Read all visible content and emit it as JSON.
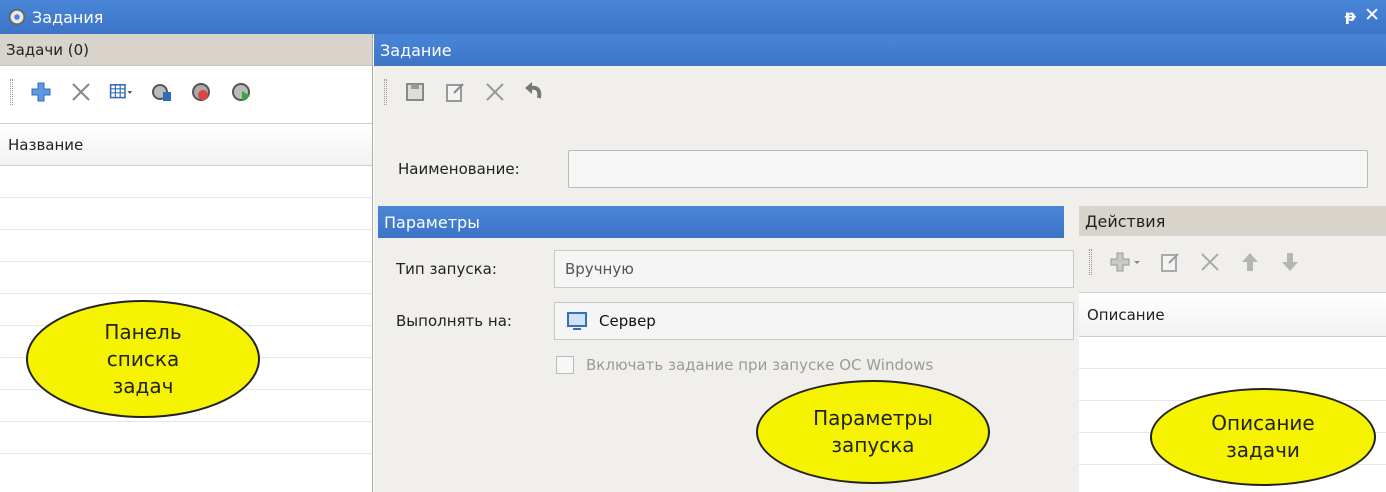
{
  "window": {
    "title": "Задания",
    "pin_glyph": "ᵽ",
    "close_glyph": "✕"
  },
  "left_panel": {
    "header": "Задачи (0)",
    "toolbar": [
      "add-icon",
      "delete-icon",
      "view-grid-icon",
      "task-run-icon",
      "task-stop-icon",
      "task-start-icon"
    ],
    "column_header": "Название",
    "row_count": 9
  },
  "task_panel": {
    "header": "Задание",
    "toolbar": [
      "save-icon",
      "edit-icon",
      "delete-icon",
      "undo-icon"
    ],
    "name_label": "Наименование:",
    "name_value": ""
  },
  "params_panel": {
    "header": "Параметры",
    "launch_type_label": "Тип запуска:",
    "launch_type_value": "Вручную",
    "run_on_label": "Выполнять на:",
    "run_on_value": "Сервер",
    "checkbox_label": "Включать задание при запуске ОС Windows",
    "checkbox_checked": false
  },
  "actions_panel": {
    "header": "Действия",
    "toolbar": [
      "add-icon",
      "edit-icon",
      "delete-icon",
      "move-up-icon",
      "move-down-icon"
    ],
    "column_header": "Описание"
  },
  "callouts": {
    "task_list": "Панель\nсписка\nзадач",
    "launch_params": "Параметры\nзапуска",
    "task_desc": "Описание\nзадачи"
  },
  "colors": {
    "accent": "#3c74c6",
    "callout": "#f5f300"
  }
}
